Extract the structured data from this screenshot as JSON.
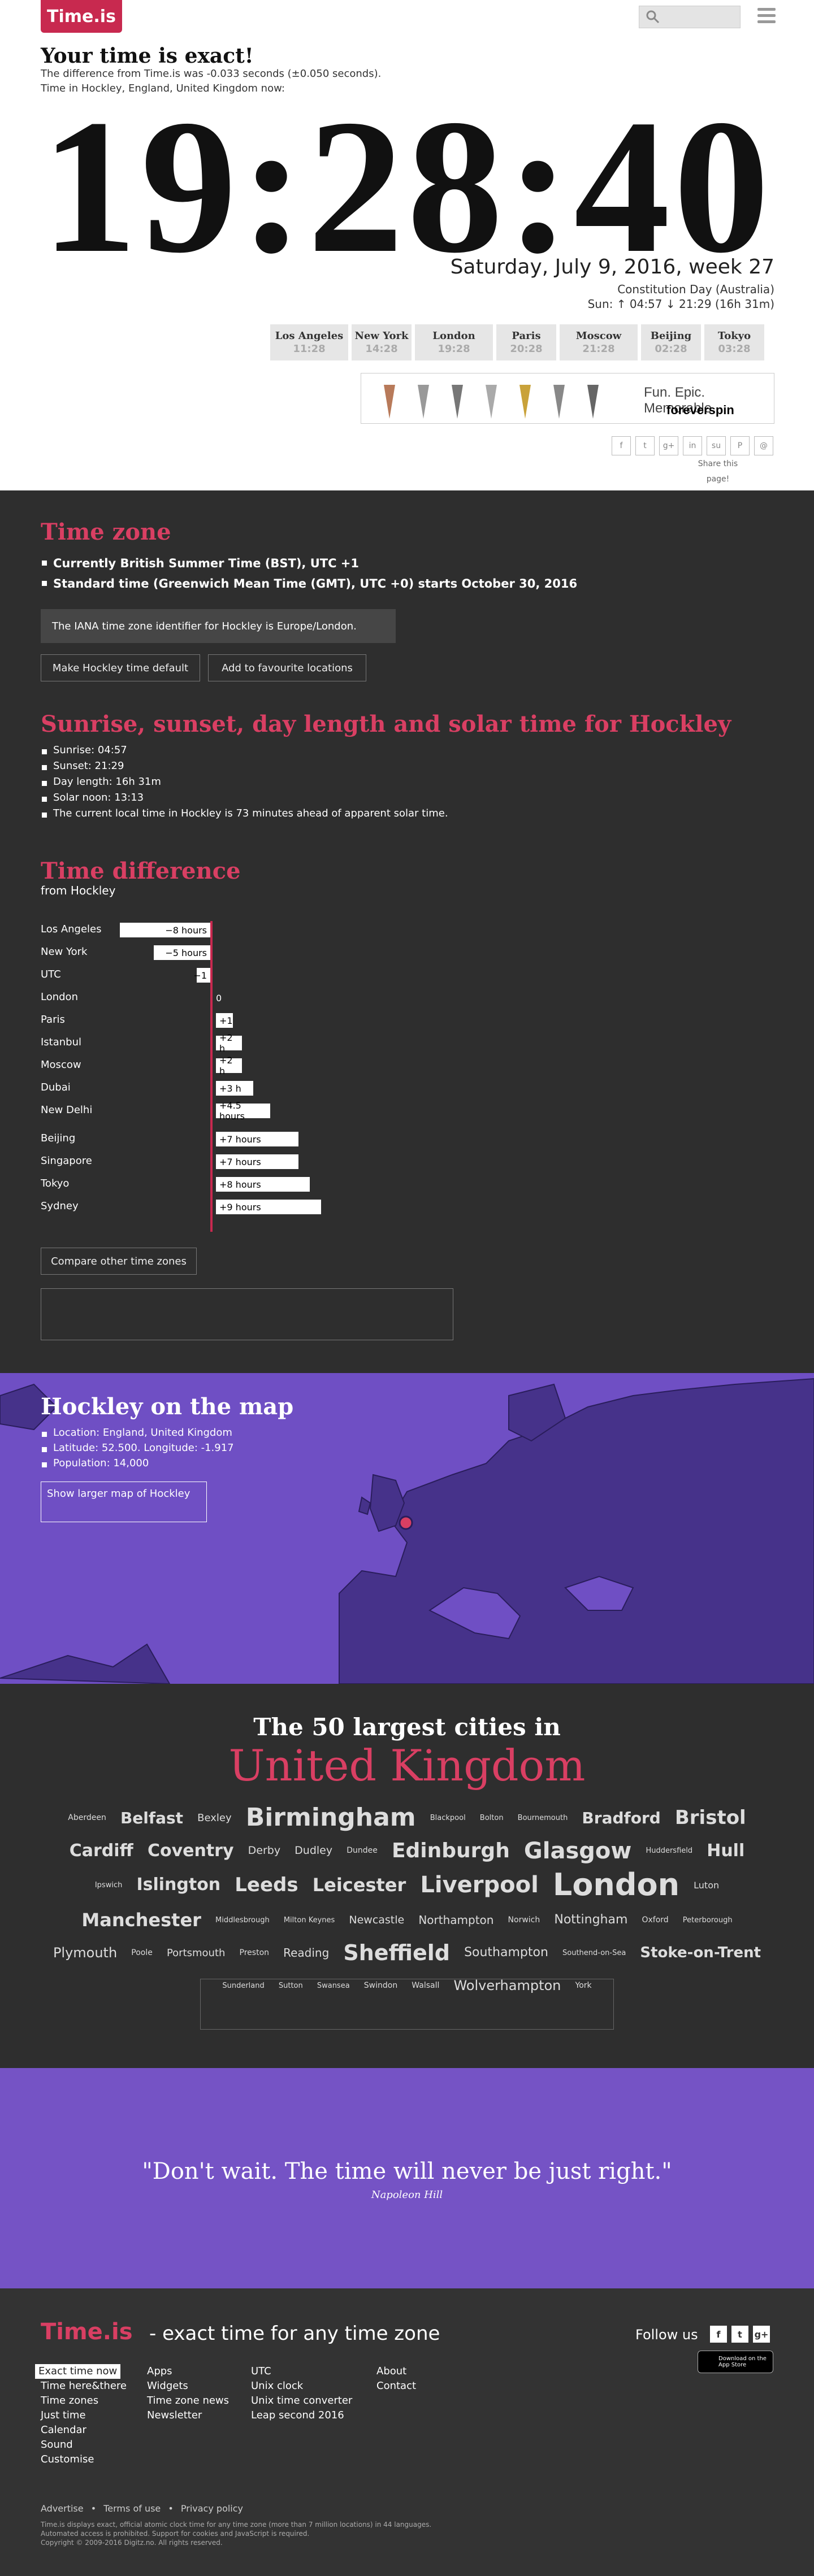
{
  "header": {
    "logo": "Time.is",
    "search_placeholder": "",
    "icons": [
      "search-icon",
      "menu-icon"
    ]
  },
  "status": {
    "headline": "Your time is exact!",
    "difference": "The difference from Time.is was -0.033 seconds (±0.050 seconds).",
    "location_line": "Time in Hockley, England, United Kingdom now:"
  },
  "clock": {
    "time": "19:28:40",
    "date": "Saturday, July 9, 2016, week 27",
    "holiday": "Constitution Day (Australia)",
    "sun": "Sun: ↑ 04:57 ↓ 21:29 (16h 31m)"
  },
  "world_clocks": [
    {
      "city": "Los Angeles",
      "time": "11:28"
    },
    {
      "city": "New York",
      "time": "14:28"
    },
    {
      "city": "London",
      "time": "19:28"
    },
    {
      "city": "Paris",
      "time": "20:28"
    },
    {
      "city": "Moscow",
      "time": "21:28"
    },
    {
      "city": "Beijing",
      "time": "02:28"
    },
    {
      "city": "Tokyo",
      "time": "03:28"
    }
  ],
  "ad": {
    "text": "Fun. Epic. Memorable.",
    "brand": "foreverspin"
  },
  "share": {
    "buttons": [
      "f",
      "t",
      "g+",
      "in",
      "su",
      "P",
      "@"
    ],
    "label": "Share this page!"
  },
  "timezone": {
    "title": "Time zone",
    "items": [
      "Currently British Summer Time (BST), UTC +1",
      "Standard time (Greenwich Mean Time (GMT), UTC +0) starts October 30, 2016"
    ],
    "iana": "The IANA time zone identifier for Hockley is Europe/London.",
    "btn_default": "Make Hockley time default",
    "btn_favourite": "Add to favourite locations"
  },
  "sun": {
    "title": "Sunrise, sunset, day length and solar time for Hockley",
    "items": [
      "Sunrise: 04:57",
      "Sunset: 21:29",
      "Day length: 16h 31m",
      "Solar noon: 13:13",
      "The current local time in Hockley is 73 minutes ahead of apparent solar time."
    ]
  },
  "difference": {
    "title": "Time difference",
    "subtitle": "from Hockley",
    "rows": [
      {
        "city": "Los Angeles",
        "label": "−8 hours",
        "hours": -8
      },
      {
        "city": "New York",
        "label": "−5 hours",
        "hours": -5
      },
      {
        "city": "UTC",
        "label": "−1",
        "hours": -1
      },
      {
        "city": "London",
        "label": "0",
        "hours": 0
      },
      {
        "city": "Paris",
        "label": "+1",
        "hours": 1
      },
      {
        "city": "Istanbul",
        "label": "+2 h",
        "hours": 2
      },
      {
        "city": "Moscow",
        "label": "+2 h",
        "hours": 2
      },
      {
        "city": "Dubai",
        "label": "+3 h",
        "hours": 3
      },
      {
        "city": "New Delhi",
        "label": "+4.5 hours",
        "hours": 4.5
      },
      {
        "city": "Beijing",
        "label": "+7 hours",
        "hours": 7
      },
      {
        "city": "Singapore",
        "label": "+7 hours",
        "hours": 7
      },
      {
        "city": "Tokyo",
        "label": "+8 hours",
        "hours": 8
      },
      {
        "city": "Sydney",
        "label": "+9 hours",
        "hours": 9
      }
    ],
    "compare_btn": "Compare other time zones"
  },
  "map": {
    "title": "Hockley on the map",
    "items": [
      "Location: England, United Kingdom",
      "Latitude: 52.500. Longitude: -1.917",
      "Population: 14,000"
    ],
    "larger_btn": "Show larger map of Hockley"
  },
  "largest": {
    "title1": "The 50 largest cities in",
    "title2": "United Kingdom",
    "cities": [
      {
        "name": "Aberdeen",
        "size": 14
      },
      {
        "name": "Belfast",
        "size": 28
      },
      {
        "name": "Bexley",
        "size": 18
      },
      {
        "name": "Birmingham",
        "size": 44
      },
      {
        "name": "Blackpool",
        "size": 13
      },
      {
        "name": "Bolton",
        "size": 13
      },
      {
        "name": "Bournemouth",
        "size": 13
      },
      {
        "name": "Bradford",
        "size": 28
      },
      {
        "name": "Bristol",
        "size": 34
      },
      {
        "name": "Cardiff",
        "size": 30
      },
      {
        "name": "Coventry",
        "size": 30
      },
      {
        "name": "Derby",
        "size": 19
      },
      {
        "name": "Dudley",
        "size": 19
      },
      {
        "name": "Dundee",
        "size": 14
      },
      {
        "name": "Edinburgh",
        "size": 36
      },
      {
        "name": "Glasgow",
        "size": 40
      },
      {
        "name": "Huddersfield",
        "size": 13
      },
      {
        "name": "Hull",
        "size": 30
      },
      {
        "name": "Ipswich",
        "size": 13
      },
      {
        "name": "Islington",
        "size": 30
      },
      {
        "name": "Leeds",
        "size": 34
      },
      {
        "name": "Leicester",
        "size": 32
      },
      {
        "name": "Liverpool",
        "size": 40
      },
      {
        "name": "London",
        "size": 54
      },
      {
        "name": "Luton",
        "size": 16
      },
      {
        "name": "Manchester",
        "size": 32
      },
      {
        "name": "Middlesbrough",
        "size": 13
      },
      {
        "name": "Milton Keynes",
        "size": 13
      },
      {
        "name": "Newcastle",
        "size": 19
      },
      {
        "name": "Northampton",
        "size": 20
      },
      {
        "name": "Norwich",
        "size": 14
      },
      {
        "name": "Nottingham",
        "size": 22
      },
      {
        "name": "Oxford",
        "size": 14
      },
      {
        "name": "Peterborough",
        "size": 13
      },
      {
        "name": "Plymouth",
        "size": 24
      },
      {
        "name": "Poole",
        "size": 14
      },
      {
        "name": "Portsmouth",
        "size": 18
      },
      {
        "name": "Preston",
        "size": 14
      },
      {
        "name": "Reading",
        "size": 20
      },
      {
        "name": "Sheffield",
        "size": 38
      },
      {
        "name": "Southampton",
        "size": 22
      },
      {
        "name": "Southend-on-Sea",
        "size": 13
      },
      {
        "name": "Stoke-on-Trent",
        "size": 26
      },
      {
        "name": "Sunderland",
        "size": 13
      },
      {
        "name": "Sutton",
        "size": 13
      },
      {
        "name": "Swansea",
        "size": 13
      },
      {
        "name": "Swindon",
        "size": 14
      },
      {
        "name": "Walsall",
        "size": 14
      },
      {
        "name": "Wolverhampton",
        "size": 24
      },
      {
        "name": "York",
        "size": 14
      }
    ]
  },
  "quote": {
    "text": "\"Don't wait. The time will never be just right.\"",
    "author": "Napoleon Hill"
  },
  "footer": {
    "logo": "Time.is",
    "tagline": "- exact time for any time zone",
    "follow": "Follow us",
    "social": [
      "f",
      "t",
      "g+"
    ],
    "appstore": "Download on the App Store",
    "col1": [
      "Exact time now",
      "Time here&there",
      "Time zones",
      "Just time",
      "Calendar",
      "Sound",
      "Customise"
    ],
    "col2": [
      "Apps",
      "Widgets",
      "Time zone news",
      "Newsletter"
    ],
    "col3": [
      "UTC",
      "Unix clock",
      "Unix time converter",
      "Leap second 2016"
    ],
    "col4": [
      "About",
      "Contact"
    ],
    "legal": [
      "Advertise",
      "Terms of use",
      "Privacy policy"
    ],
    "fine1": "Time.is displays exact, official atomic clock time for any time zone (more than 7 million locations) in 44 languages.",
    "fine2": "Automated access is prohibited. Support for cookies and JavaScript is required.",
    "fine3": "Copyright © 2009-2016 Digitz.no. All rights reserved."
  },
  "colors": {
    "accent": "#c8294f",
    "dark": "#2e2e2e",
    "purple": "#6f4fc4"
  }
}
